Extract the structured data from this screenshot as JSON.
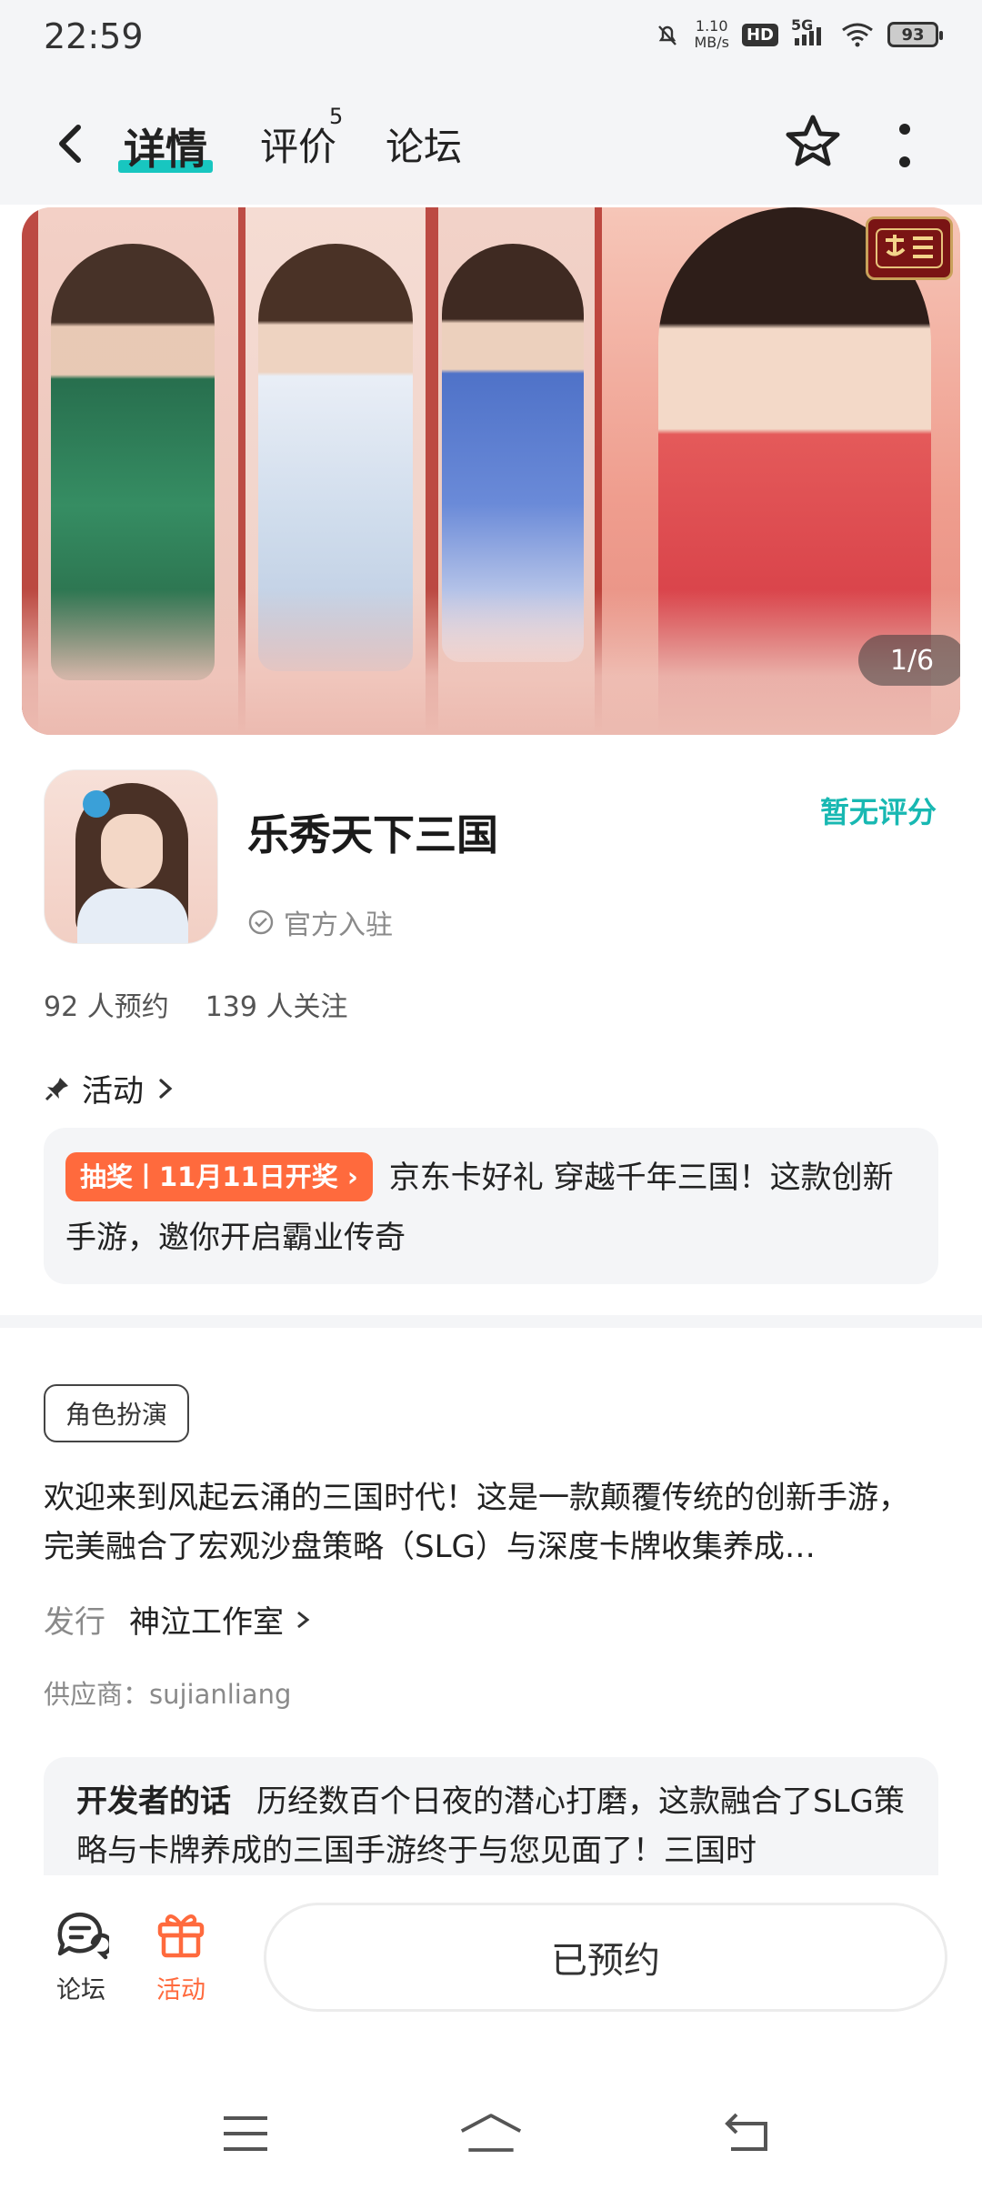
{
  "status_bar": {
    "time": "22:59",
    "net_speed_value": "1.10",
    "net_speed_unit": "MB/s",
    "hd": "HD",
    "network": "5G",
    "battery": "93"
  },
  "nav": {
    "tabs": [
      {
        "label": "详情",
        "active": true
      },
      {
        "label": "评价",
        "badge": "5"
      },
      {
        "label": "论坛"
      }
    ]
  },
  "banner": {
    "counter": "1/6",
    "logo_text": "乐秀天下三国"
  },
  "app": {
    "name": "乐秀天下三国",
    "official": "官方入驻",
    "rating": "暂无评分",
    "reservations": "92 人预约",
    "followers": "139 人关注"
  },
  "activity": {
    "heading": "活动",
    "badge": "抽奖丨11月11日开奖",
    "text": "京东卡好礼 穿越千年三国！这款创新手游，邀你开启霸业传奇"
  },
  "details": {
    "tag": "角色扮演",
    "description": "欢迎来到风起云涌的三国时代！这是一款颠覆传统的创新手游，完美融合了宏观沙盘策略（SLG）与深度卡牌收集养成…",
    "publisher_label": "发行",
    "publisher_value": "神泣工作室",
    "supplier": "供应商：sujianliang"
  },
  "developer": {
    "title": "开发者的话",
    "text": "历经数百个日夜的潜心打磨，这款融合了SLG策略与卡牌养成的三国手游终于与您见面了！三国时"
  },
  "bottom_bar": {
    "forum_label": "论坛",
    "activity_label": "活动",
    "reserve_label": "已预约"
  },
  "colors": {
    "accent": "#18c6c0",
    "rating": "#18b8b2",
    "lottery": "#ff6a3d",
    "activity_icon": "#ff6a3d"
  },
  "icons": {
    "back": "chevron-left-icon",
    "favorite": "star-icon",
    "more": "more-vertical-icon",
    "official": "check-circle-icon",
    "activity": "pin-icon",
    "forum": "chat-bubble-icon",
    "gift": "gift-icon"
  }
}
